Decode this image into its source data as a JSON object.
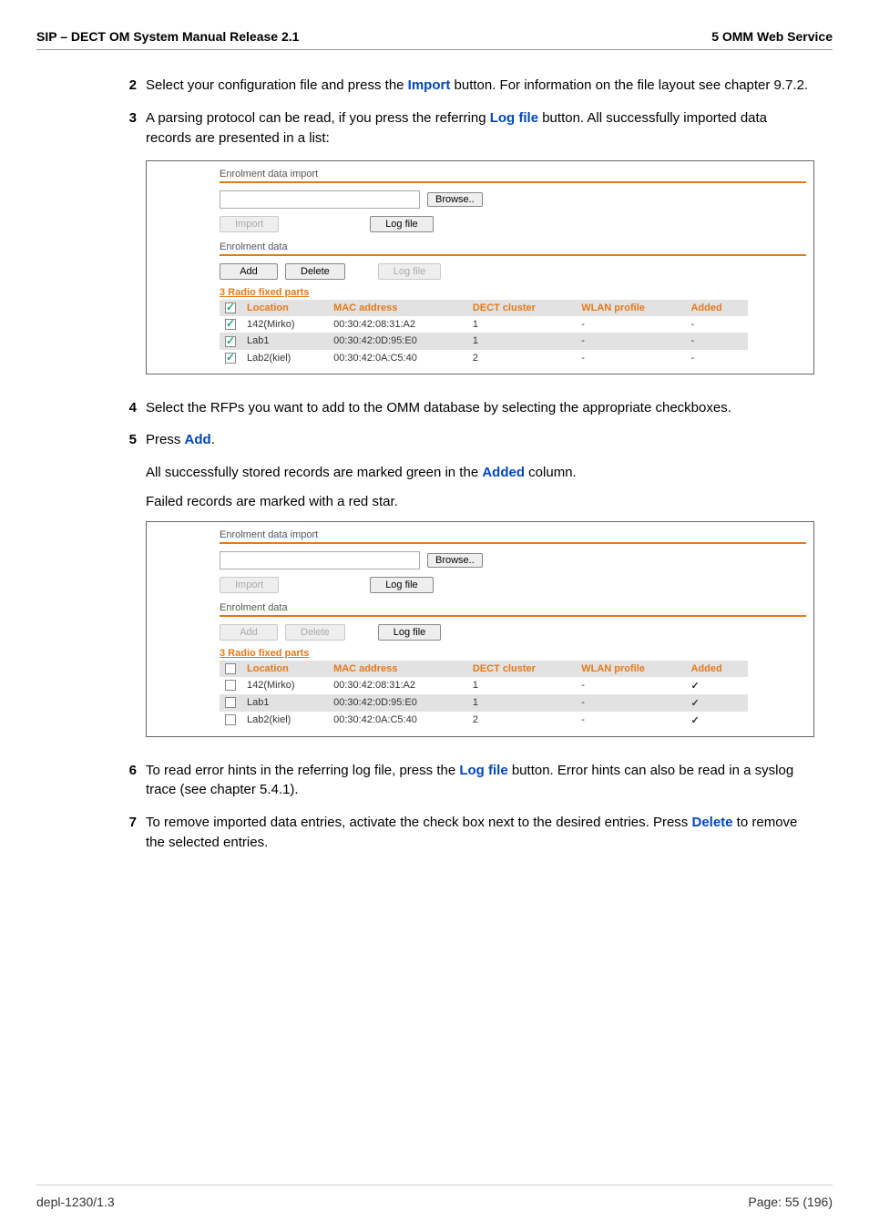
{
  "header": {
    "left": "SIP – DECT OM System Manual Release 2.1",
    "right": "5 OMM Web Service"
  },
  "steps": {
    "s2": {
      "num": "2",
      "text_a": "Select your configuration file and press the ",
      "kw": "Import",
      "text_b": " button. For information on the file layout see chapter 9.7.2."
    },
    "s3": {
      "num": "3",
      "text_a": "A parsing protocol can be read, if you press the referring ",
      "kw": "Log file",
      "text_b": " button. All successfully imported data records are presented in a list:"
    },
    "s4": {
      "num": "4",
      "text": "Select the RFPs you want to add to the OMM database by selecting the appropriate checkboxes."
    },
    "s5": {
      "num": "5",
      "text_a": "Press ",
      "kw": "Add",
      "text_b": ".",
      "line2_a": "All successfully stored records are marked green in the ",
      "line2_kw": "Added",
      "line2_b": " column.",
      "line3": "Failed records are marked with a red star."
    },
    "s6": {
      "num": "6",
      "text_a": "To read error hints in the referring log file, press the ",
      "kw": "Log file",
      "text_b": " button. Error hints can also be read in a syslog trace (see chapter 5.4.1)."
    },
    "s7": {
      "num": "7",
      "text_a": "To remove imported data entries, activate the check box next to the desired entries. Press ",
      "kw": "Delete",
      "text_b": " to remove the selected entries."
    }
  },
  "shot1": {
    "title1": "Enrolment data import",
    "browse": "Browse..",
    "import": "Import",
    "logfile": "Log file",
    "title2": "Enrolment data",
    "add": "Add",
    "delete": "Delete",
    "logfile2": "Log file",
    "count_label": "3 Radio fixed parts",
    "cols": {
      "loc": "Location",
      "mac": "MAC address",
      "dect": "DECT cluster",
      "wlan": "WLAN profile",
      "added": "Added"
    },
    "rows": [
      {
        "checked": true,
        "loc": "142(Mirko)",
        "mac": "00:30:42:08:31:A2",
        "dect": "1",
        "wlan": "-",
        "added": "-"
      },
      {
        "checked": true,
        "loc": "Lab1",
        "mac": "00:30:42:0D:95:E0",
        "dect": "1",
        "wlan": "-",
        "added": "-"
      },
      {
        "checked": true,
        "loc": "Lab2(kiel)",
        "mac": "00:30:42:0A:C5:40",
        "dect": "2",
        "wlan": "-",
        "added": "-"
      }
    ]
  },
  "shot2": {
    "title1": "Enrolment data import",
    "browse": "Browse..",
    "import": "Import",
    "logfile": "Log file",
    "title2": "Enrolment data",
    "add": "Add",
    "delete": "Delete",
    "logfile2": "Log file",
    "count_label": "3 Radio fixed parts",
    "cols": {
      "loc": "Location",
      "mac": "MAC address",
      "dect": "DECT cluster",
      "wlan": "WLAN profile",
      "added": "Added"
    },
    "rows": [
      {
        "checked": false,
        "loc": "142(Mirko)",
        "mac": "00:30:42:08:31:A2",
        "dect": "1",
        "wlan": "-",
        "added": "✓"
      },
      {
        "checked": false,
        "loc": "Lab1",
        "mac": "00:30:42:0D:95:E0",
        "dect": "1",
        "wlan": "-",
        "added": "✓"
      },
      {
        "checked": false,
        "loc": "Lab2(kiel)",
        "mac": "00:30:42:0A:C5:40",
        "dect": "2",
        "wlan": "-",
        "added": "✓"
      }
    ]
  },
  "footer": {
    "left": "depl-1230/1.3",
    "right": "Page: 55 (196)"
  }
}
